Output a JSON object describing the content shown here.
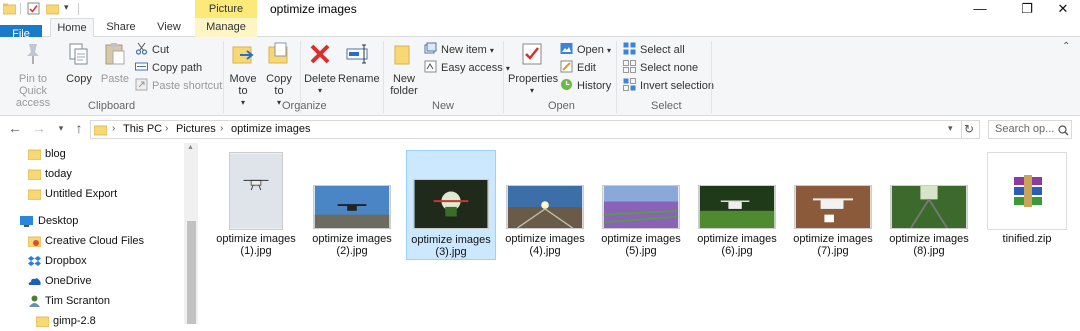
{
  "window": {
    "title": "optimize images",
    "context_tab_group": "Picture Tools",
    "controls": {
      "minimize": "—",
      "maximize": "❐",
      "close": "✕"
    }
  },
  "ribbon_tabs": [
    {
      "label": "File"
    },
    {
      "label": "Home"
    },
    {
      "label": "Share"
    },
    {
      "label": "View"
    },
    {
      "label": "Manage"
    }
  ],
  "ribbon": {
    "clipboard": {
      "label": "Clipboard",
      "pin": "Pin to Quick access",
      "copy": "Copy",
      "paste": "Paste",
      "cut": "Cut",
      "copy_path": "Copy path",
      "paste_shortcut": "Paste shortcut"
    },
    "organize": {
      "label": "Organize",
      "move_to": "Move to",
      "copy_to": "Copy to",
      "delete": "Delete",
      "rename": "Rename"
    },
    "new": {
      "label": "New",
      "new_folder": "New folder",
      "new_item": "New item",
      "easy_access": "Easy access"
    },
    "open": {
      "label": "Open",
      "properties": "Properties",
      "open": "Open",
      "edit": "Edit",
      "history": "History"
    },
    "select": {
      "label": "Select",
      "select_all": "Select all",
      "select_none": "Select none",
      "invert_selection": "Invert selection"
    }
  },
  "address": {
    "breadcrumbs": [
      "This PC",
      "Pictures",
      "optimize images"
    ],
    "search_placeholder": "Search op..."
  },
  "nav_pane": [
    {
      "label": "blog",
      "icon": "folder-icon"
    },
    {
      "label": "today",
      "icon": "folder-icon"
    },
    {
      "label": "Untitled Export",
      "icon": "folder-icon"
    },
    {
      "label": "Desktop",
      "icon": "desktop-icon"
    },
    {
      "label": "Creative Cloud Files",
      "icon": "creative-cloud-icon"
    },
    {
      "label": "Dropbox",
      "icon": "dropbox-icon"
    },
    {
      "label": "OneDrive",
      "icon": "onedrive-icon"
    },
    {
      "label": "Tim Scranton",
      "icon": "user-icon"
    },
    {
      "label": "gimp-2.8",
      "icon": "folder-icon"
    }
  ],
  "files": [
    {
      "line1": "optimize images",
      "line2": "(1).jpg",
      "selected": false
    },
    {
      "line1": "optimize images",
      "line2": "(2).jpg",
      "selected": false
    },
    {
      "line1": "optimize images",
      "line2": "(3).jpg",
      "selected": true
    },
    {
      "line1": "optimize images",
      "line2": "(4).jpg",
      "selected": false
    },
    {
      "line1": "optimize images",
      "line2": "(5).jpg",
      "selected": false
    },
    {
      "line1": "optimize images",
      "line2": "(6).jpg",
      "selected": false
    },
    {
      "line1": "optimize images",
      "line2": "(7).jpg",
      "selected": false
    },
    {
      "line1": "optimize images",
      "line2": "(8).jpg",
      "selected": false
    },
    {
      "line1": "tinified.zip",
      "line2": "",
      "selected": false
    }
  ],
  "colors": {
    "file_tab": "#1979ca",
    "picture_tools": "#fbe97a",
    "selection_fill": "#cce8ff",
    "selection_border": "#99d1ff",
    "folder": "#f8d775"
  }
}
